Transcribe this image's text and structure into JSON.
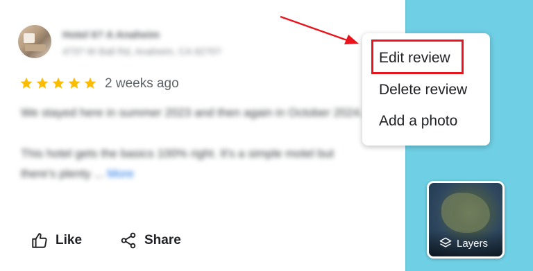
{
  "review": {
    "place_name": "Hotel 6? A Anaheim",
    "place_address": "4?3? W Ball Rd, Anaheim, CA 92?0?",
    "rating": 5,
    "time_ago": "2 weeks ago",
    "paragraph1": "We stayed here in summer 2023 and then again in October 2024.",
    "paragraph2": "This hotel gets the basics 100% right. It's a simple motel but there's plenty ...",
    "more_label": "More"
  },
  "actions": {
    "like_label": "Like",
    "share_label": "Share"
  },
  "menu": {
    "items": [
      {
        "label": "Edit review"
      },
      {
        "label": "Delete review"
      },
      {
        "label": "Add a photo"
      }
    ]
  },
  "map": {
    "layers_label": "Layers"
  },
  "colors": {
    "star": "#fbbc04",
    "annotation": "#e8141d",
    "map_water": "#6fcfe4",
    "link": "#1a73e8"
  }
}
